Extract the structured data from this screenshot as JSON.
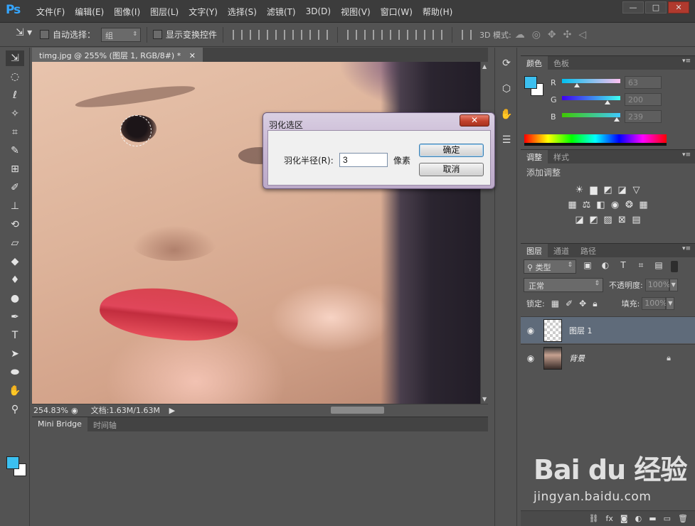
{
  "app": {
    "logo": "Ps"
  },
  "menu": [
    "文件(F)",
    "编辑(E)",
    "图像(I)",
    "图层(L)",
    "文字(Y)",
    "选择(S)",
    "滤镜(T)",
    "3D(D)",
    "视图(V)",
    "窗口(W)",
    "帮助(H)"
  ],
  "window_controls": {
    "minimize": "—",
    "maximize": "□",
    "close": "✕"
  },
  "options_bar": {
    "auto_select_label": "自动选择：",
    "auto_select_value": "组",
    "show_transform_label": "显示变换控件",
    "mode_3d_label": "3D 模式:"
  },
  "document": {
    "tab_title": "timg.jpg @ 255% (图层 1, RGB/8#) *",
    "tab_close": "✕"
  },
  "status": {
    "zoom": "254.83%",
    "doc_info": "文档:1.63M/1.63M"
  },
  "bottom_panel": {
    "tabs": [
      "Mini Bridge",
      "时间轴"
    ]
  },
  "color_panel": {
    "tabs": [
      "颜色",
      "色板"
    ],
    "foreground": "#3cc0f0",
    "background": "#ffffff",
    "channels": [
      {
        "label": "R",
        "value": "63",
        "fraction": 0.25
      },
      {
        "label": "G",
        "value": "200",
        "fraction": 0.78
      },
      {
        "label": "B",
        "value": "239",
        "fraction": 0.94
      }
    ]
  },
  "adjustments_panel": {
    "tabs": [
      "调整",
      "样式"
    ],
    "title": "添加调整"
  },
  "layers_panel": {
    "tabs": [
      "图层",
      "通道",
      "路径"
    ],
    "kind_filter": "类型",
    "blend_mode": "正常",
    "opacity_label": "不透明度:",
    "opacity_value": "100%",
    "lock_label": "锁定:",
    "fill_label": "填充:",
    "fill_value": "100%",
    "layers": [
      {
        "name": "图层 1",
        "selected": true
      },
      {
        "name": "背景",
        "selected": false,
        "locked": true
      }
    ]
  },
  "feather_dialog": {
    "title": "羽化选区",
    "radius_label": "羽化半径(R):",
    "radius_value": "3",
    "unit": "像素",
    "ok_label": "确定",
    "cancel_label": "取消"
  },
  "watermark": {
    "brand": "Bai du 经验",
    "url": "jingyan.baidu.com"
  }
}
